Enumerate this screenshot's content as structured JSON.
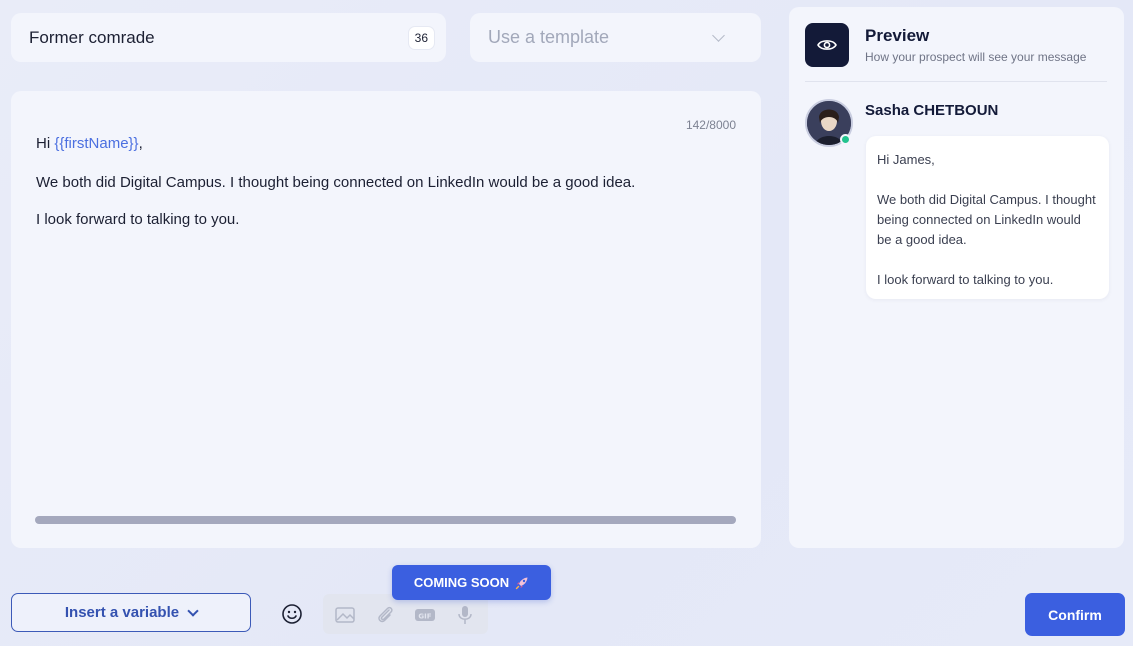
{
  "message_name": {
    "value": "Former comrade",
    "char_count": "36"
  },
  "template_select": {
    "placeholder": "Use a template"
  },
  "editor": {
    "counter": "142/8000",
    "greeting_prefix": "Hi ",
    "greeting_variable": "{{firstName}}",
    "greeting_suffix": ",",
    "line2": "We both did Digital Campus. I thought being connected on LinkedIn would be a good idea.",
    "line3": "I look forward to talking to you."
  },
  "preview": {
    "title": "Preview",
    "subtitle": "How your prospect will see your message",
    "sender_name": "Sasha CHETBOUN",
    "bubble": {
      "greeting": "Hi James,",
      "body": "We both did Digital Campus. I thought being connected on LinkedIn would be a good idea.",
      "closing": "I look forward to talking to you."
    }
  },
  "toolbar": {
    "insert_variable_label": "Insert a variable",
    "coming_soon_label": "COMING SOON",
    "confirm_label": "Confirm",
    "icons": [
      "emoji-icon",
      "image-icon",
      "paperclip-icon",
      "gif-icon",
      "microphone-icon",
      "rocket-icon"
    ]
  },
  "colors": {
    "accent": "#3b5fe0",
    "variable": "#4b6fe0",
    "online": "#22c38e",
    "dark": "#131a38"
  }
}
